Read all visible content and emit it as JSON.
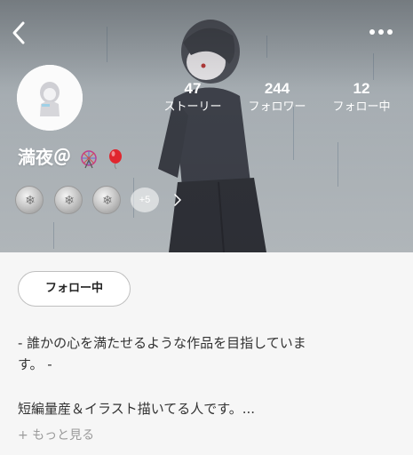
{
  "profile": {
    "name": "満夜＠",
    "name_emojis": [
      "ferris-wheel-emoji",
      "balloon-emoji"
    ],
    "stats": [
      {
        "value": "47",
        "label": "ストーリー"
      },
      {
        "value": "244",
        "label": "フォロワー"
      },
      {
        "value": "12",
        "label": "フォロー中"
      }
    ],
    "badges": {
      "more_count": "+5"
    }
  },
  "actions": {
    "follow_label": "フォロー中"
  },
  "bio": {
    "line1": "-  誰かの心を満たせるような作品を目指していま",
    "line2": "す。 -",
    "line3": "短編量産＆イラスト描いてる人です。...",
    "more_label": "+ もっと見る"
  },
  "icons": [
    "back-icon",
    "more-options-icon",
    "chevron-right-icon"
  ],
  "colors": {
    "header_text": "#ffffff",
    "page_bg": "#f6f6f6",
    "button_border": "#bfbfbf"
  }
}
